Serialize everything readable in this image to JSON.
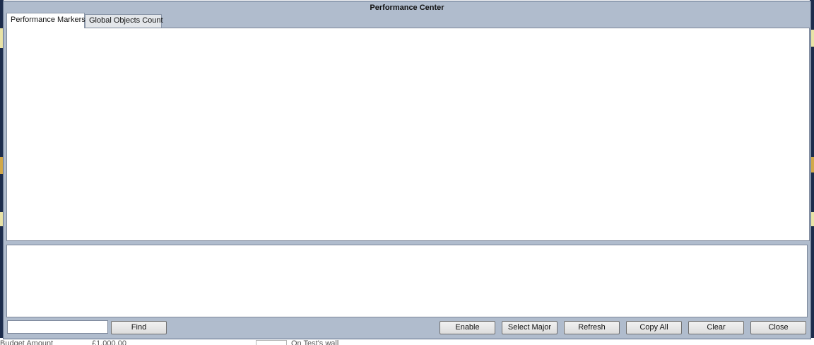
{
  "window": {
    "title": "Performance Center"
  },
  "tabs": [
    {
      "label": "Performance Markers",
      "active": true
    },
    {
      "label": "Global Objects Count",
      "active": false
    }
  ],
  "search": {
    "value": "",
    "placeholder": ""
  },
  "buttons": {
    "find": "Find",
    "enable": "Enable",
    "select_major": "Select Major",
    "refresh": "Refresh",
    "copy_all": "Copy All",
    "clear": "Clear",
    "close": "Close"
  },
  "background": {
    "budget_label": "Budget Amount",
    "budget_value": "£1,000.00",
    "wall_label": "On Test's wall"
  },
  "colors": {
    "dialog_background": "#b0bccd",
    "panel_background": "#ffffff",
    "border": "#7d889b"
  }
}
